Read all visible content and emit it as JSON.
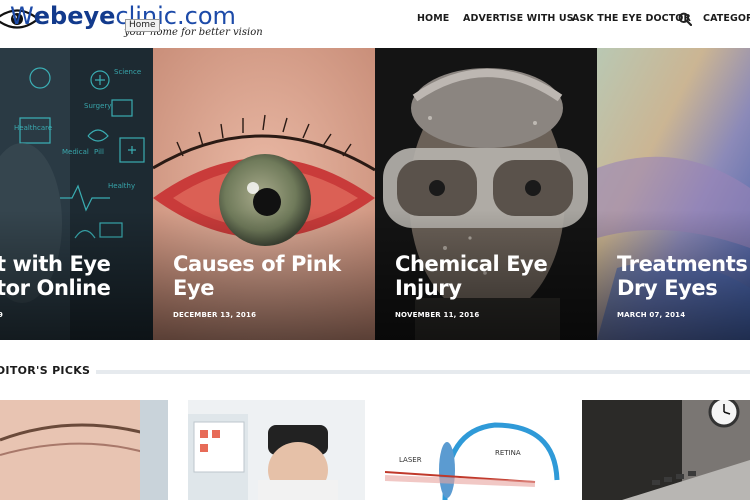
{
  "header": {
    "logo": {
      "prefix": "W",
      "bold": "ebeye",
      "rest": "clinic.com",
      "tagline": "your home for better vision"
    },
    "tooltip": "Home",
    "nav": [
      {
        "label": "HOME"
      },
      {
        "label": "ADVERTISE WITH US"
      },
      {
        "label": "ASK THE EYE DOCTOR"
      },
      {
        "label": "CATEGORIES"
      }
    ],
    "search_icon": "search-icon"
  },
  "slider": {
    "slides": [
      {
        "title_line1": "t with Eye",
        "title_line2": "tor Online",
        "date": "9"
      },
      {
        "title_line1": "Causes of Pink",
        "title_line2": "Eye",
        "date": "DECEMBER 13, 2016"
      },
      {
        "title_line1": "Chemical Eye",
        "title_line2": "Injury",
        "date": "NOVEMBER 11, 2016"
      },
      {
        "title_line1": "Treatments",
        "title_line2": "Dry Eyes",
        "date": "MARCH 07, 2014"
      }
    ]
  },
  "editors_picks": {
    "title": "DITOR'S PICKS",
    "diagram_labels": {
      "laser": "LASER",
      "retina": "RETINA"
    }
  },
  "colors": {
    "logo_blue": "#1c4aa8",
    "nav_text": "#1b1b1b",
    "divider": "#e6eaee"
  }
}
